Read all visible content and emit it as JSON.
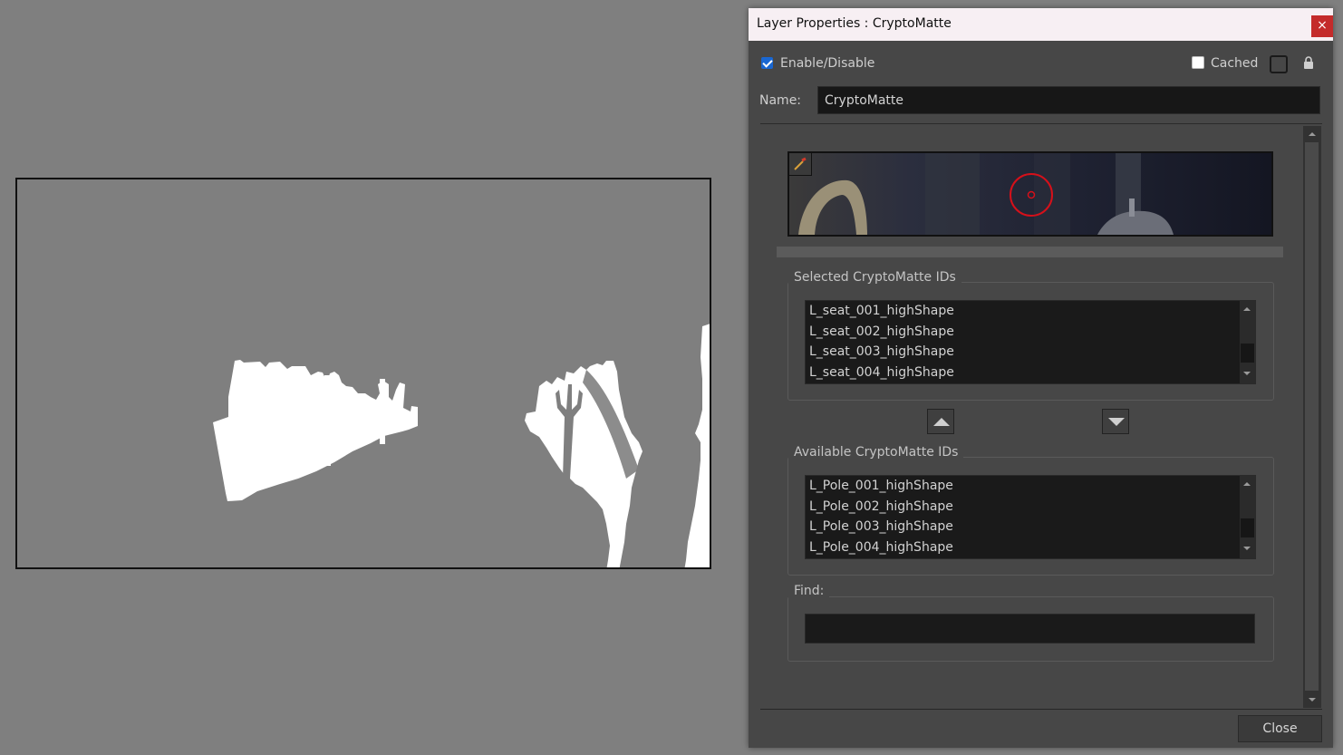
{
  "dialog": {
    "title": "Layer Properties : CryptoMatte",
    "close_glyph": "×",
    "enable_label": "Enable/Disable",
    "enable_checked": true,
    "cached_label": "Cached",
    "cached_checked": false,
    "name_label": "Name:",
    "name_value": "CryptoMatte",
    "selected_group_label": "Selected CryptoMatte IDs",
    "selected_ids": [
      "L_seat_001_highShape",
      "L_seat_002_highShape",
      "L_seat_003_highShape",
      "L_seat_004_highShape"
    ],
    "available_group_label": "Available CryptoMatte IDs",
    "available_ids": [
      "L_Pole_001_highShape",
      "L_Pole_002_highShape",
      "L_Pole_003_highShape",
      "L_Pole_004_highShape"
    ],
    "find_label": "Find:",
    "find_value": "",
    "close_button_label": "Close"
  },
  "icons": {
    "picker": "color-picker-icon",
    "lock": "lock-icon",
    "move_up": "arrow-up-icon",
    "move_down": "arrow-down-icon"
  },
  "colors": {
    "checkbox_accent": "#1967d2",
    "close_red": "#c42b2b",
    "target_red": "#d6101a"
  }
}
